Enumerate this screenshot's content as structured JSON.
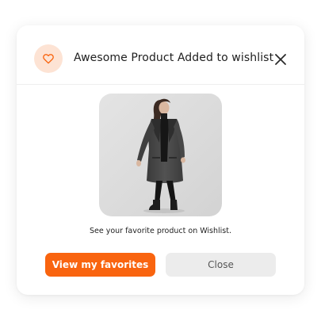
{
  "dialog": {
    "title": "Awesome Product Added to wishlist",
    "message": "See your favorite product on Wishlist.",
    "primary_button": "View my favorites",
    "secondary_button": "Close"
  },
  "icons": {
    "badge": "heart-icon",
    "close": "close-icon"
  },
  "image": {
    "subject": "product-photo"
  },
  "colors": {
    "accent": "#f9640f",
    "badge_bg": "#fde3d4",
    "secondary_bg": "#ececec"
  }
}
